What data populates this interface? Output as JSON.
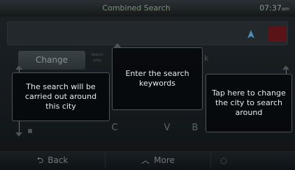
{
  "titlebar": {
    "title": "Combined Search",
    "clock": "07:37",
    "clock_suffix": "am"
  },
  "search": {
    "hint_char": "k",
    "change_label": "Change",
    "search_area_label": "Search area"
  },
  "keyboard": {
    "visible_keys": [
      "C",
      "V",
      "B"
    ]
  },
  "bottom": {
    "back_label": "Back",
    "back_icon": "back-arrow-icon",
    "more_label": "More",
    "more_icon": "chevron-up-icon"
  },
  "tooltips": {
    "city_search": "The search will be carried out around this city",
    "keywords": "Enter the search keywords",
    "change_city": "Tap here to change the city to search around"
  }
}
